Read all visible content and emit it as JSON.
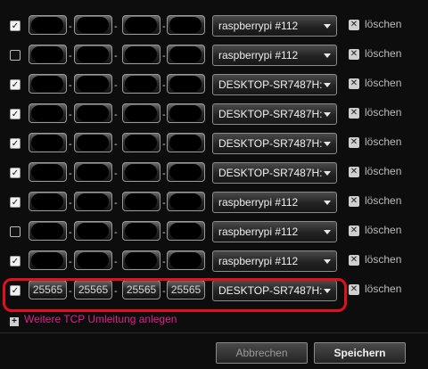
{
  "rows": [
    {
      "checked": true,
      "ports": [
        "",
        "",
        "",
        ""
      ],
      "device": "raspberrypi #112",
      "delete_label": "löschen"
    },
    {
      "checked": false,
      "ports": [
        "",
        "",
        "",
        ""
      ],
      "device": "raspberrypi #112",
      "delete_label": "löschen"
    },
    {
      "checked": true,
      "ports": [
        "",
        "",
        "",
        ""
      ],
      "device": "DESKTOP-SR7487H:",
      "delete_label": "löschen"
    },
    {
      "checked": true,
      "ports": [
        "",
        "",
        "",
        ""
      ],
      "device": "DESKTOP-SR7487H:",
      "delete_label": "löschen"
    },
    {
      "checked": true,
      "ports": [
        "",
        "",
        "",
        ""
      ],
      "device": "DESKTOP-SR7487H:",
      "delete_label": "löschen"
    },
    {
      "checked": true,
      "ports": [
        "",
        "",
        "",
        ""
      ],
      "device": "DESKTOP-SR7487H:",
      "delete_label": "löschen"
    },
    {
      "checked": true,
      "ports": [
        "",
        "",
        "",
        ""
      ],
      "device": "raspberrypi #112",
      "delete_label": "löschen"
    },
    {
      "checked": false,
      "ports": [
        "",
        "",
        "",
        ""
      ],
      "device": "raspberrypi #112",
      "delete_label": "löschen"
    },
    {
      "checked": true,
      "ports": [
        "",
        "",
        "",
        ""
      ],
      "device": "raspberrypi #112",
      "delete_label": "löschen"
    },
    {
      "checked": true,
      "ports": [
        "25565",
        "25565",
        "25565",
        "25565"
      ],
      "device": "DESKTOP-SR7487H:",
      "delete_label": "löschen"
    }
  ],
  "add_link_label": "Weitere TCP Umleitung anlegen",
  "buttons": {
    "cancel": "Abbrechen",
    "save": "Speichern"
  },
  "colors": {
    "highlight": "#e0101c",
    "link": "#e0208a"
  }
}
